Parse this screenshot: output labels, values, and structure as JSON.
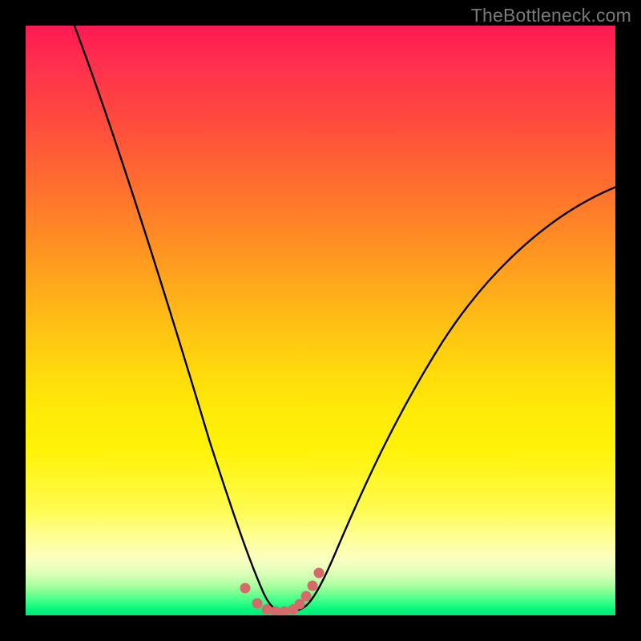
{
  "watermark": "TheBottleneck.com",
  "colors": {
    "frame": "#000000",
    "curve": "#000000",
    "markers": "#d46a6a",
    "gradient_top": "#ff1a54",
    "gradient_bottom": "#04e877"
  },
  "chart_data": {
    "type": "line",
    "title": "",
    "xlabel": "",
    "ylabel": "",
    "xlim": [
      0,
      100
    ],
    "ylim": [
      0,
      100
    ],
    "grid": false,
    "legend": false,
    "note": "No axis ticks or numeric labels are rendered; curve and marker positions are visual estimates.",
    "series": [
      {
        "name": "left-branch",
        "x": [
          8,
          12,
          16,
          20,
          24,
          27,
          29,
          31,
          33,
          34.5,
          36,
          37.5,
          39,
          40.3
        ],
        "y": [
          100,
          85,
          70,
          56,
          43,
          33,
          26,
          20,
          14,
          10,
          6.5,
          4,
          2,
          0.8
        ]
      },
      {
        "name": "valley-floor",
        "x": [
          40.3,
          41.5,
          42.8,
          44,
          45.2,
          46.3
        ],
        "y": [
          0.8,
          0.5,
          0.45,
          0.45,
          0.5,
          0.8
        ]
      },
      {
        "name": "right-branch",
        "x": [
          46.3,
          47.5,
          49,
          51,
          54,
          58,
          63,
          69,
          76,
          84,
          92,
          100
        ],
        "y": [
          0.8,
          2.2,
          4.5,
          8,
          14,
          22,
          31,
          41,
          51,
          60,
          67.5,
          73
        ]
      }
    ],
    "markers": {
      "name": "highlighted-points",
      "shape": "circle",
      "color": "#d46a6a",
      "x": [
        37.3,
        39.3,
        40.9,
        42.4,
        43.9,
        45.4,
        46.5,
        47.6,
        48.7,
        49.8
      ],
      "y": [
        4.6,
        1.9,
        0.9,
        0.55,
        0.55,
        0.9,
        1.8,
        3.2,
        5.0,
        7.2
      ]
    }
  }
}
